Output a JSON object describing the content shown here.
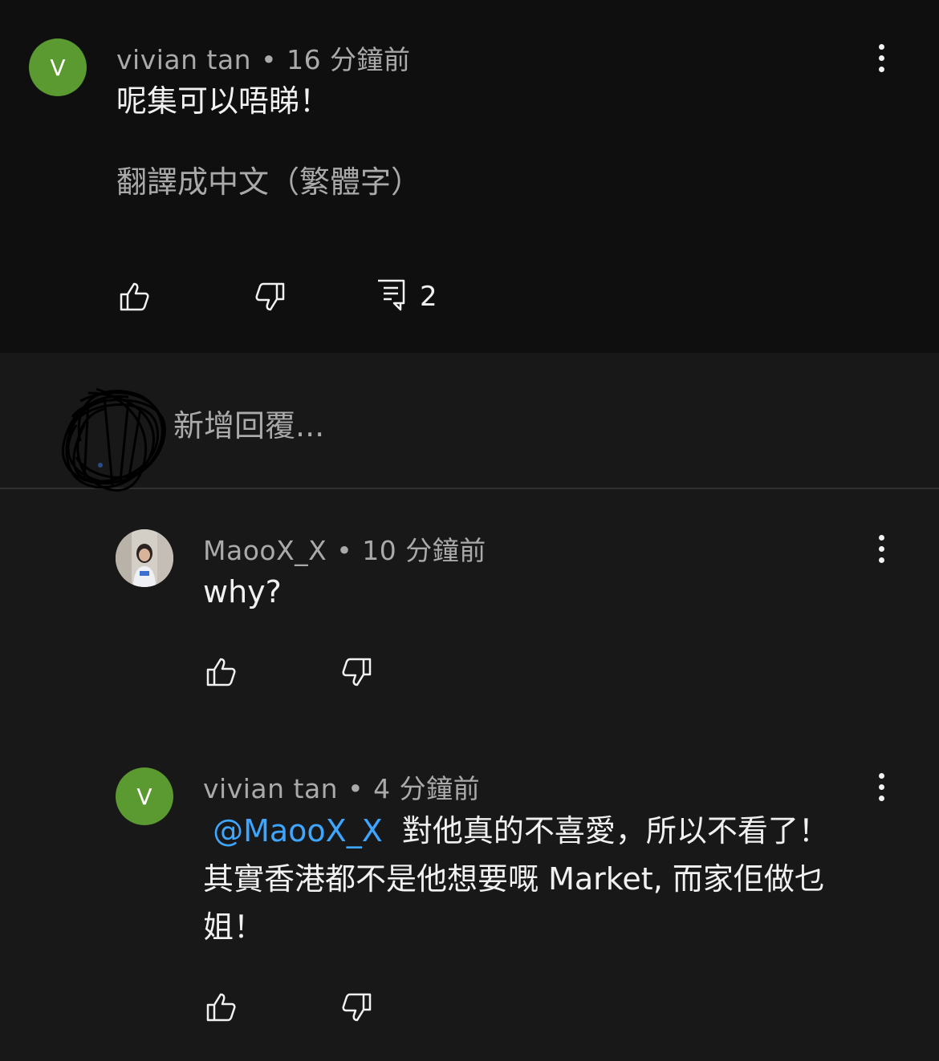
{
  "comment1": {
    "avatar_letter": "V",
    "author": "vivian tan",
    "time": "16 分鐘前",
    "text": "呢集可以唔睇！",
    "translate_label": "翻譯成中文（繁體字）",
    "reply_count": "2"
  },
  "reply_bar": {
    "placeholder": "新增回覆..."
  },
  "reply1": {
    "author": "MaooX_X",
    "time": "10 分鐘前",
    "text": "why?"
  },
  "reply2": {
    "avatar_letter": "V",
    "author": "vivian tan",
    "time": "4 分鐘前",
    "mention": "@MaooX_X",
    "line1": "對他真的不喜愛，所以不看了！",
    "line2": "其實香港都不是他想要嘅 Market, 而家佢做乜",
    "line3": "姐！"
  },
  "colors": {
    "avatar_green": "#5b9a30",
    "mention_blue": "#3ea6ff"
  }
}
